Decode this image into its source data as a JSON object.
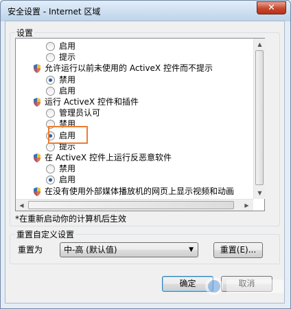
{
  "window": {
    "title": "安全设置 - Internet 区域",
    "close_label": "✕"
  },
  "settings": {
    "group_label": "设置",
    "items": [
      {
        "kind": "radio",
        "label": "启用",
        "checked": false,
        "indent": 1
      },
      {
        "kind": "radio",
        "label": "提示",
        "checked": false,
        "indent": 1
      },
      {
        "kind": "category",
        "label": "允许运行以前未使用的 ActiveX 控件而不提示"
      },
      {
        "kind": "radio",
        "label": "禁用",
        "checked": true,
        "indent": 1
      },
      {
        "kind": "radio",
        "label": "启用",
        "checked": false,
        "indent": 1
      },
      {
        "kind": "category",
        "label": "运行 ActiveX 控件和插件"
      },
      {
        "kind": "radio",
        "label": "管理员认可",
        "checked": false,
        "indent": 1
      },
      {
        "kind": "radio",
        "label": "禁用",
        "checked": false,
        "indent": 1
      },
      {
        "kind": "radio",
        "label": "启用",
        "checked": true,
        "indent": 1
      },
      {
        "kind": "radio",
        "label": "提示",
        "checked": false,
        "indent": 1
      },
      {
        "kind": "category",
        "label": "在 ActiveX 控件上运行反恶意软件"
      },
      {
        "kind": "radio",
        "label": "禁用",
        "checked": false,
        "indent": 1
      },
      {
        "kind": "radio",
        "label": "启用",
        "checked": true,
        "indent": 1
      },
      {
        "kind": "category",
        "label": "在没有使用外部媒体播放机的网页上显示视频和动画"
      }
    ],
    "note": "*在重新启动你的计算机后生效"
  },
  "reset": {
    "group_label": "重置自定义设置",
    "reset_to_label": "重置为",
    "selected_level": "中-高 (默认值)",
    "reset_button": "重置(E)..."
  },
  "footer": {
    "ok_button": "确定",
    "cancel_button": "取消"
  },
  "colors": {
    "highlight": "#ec7c30",
    "radio_dot": "#2a5fa9"
  }
}
